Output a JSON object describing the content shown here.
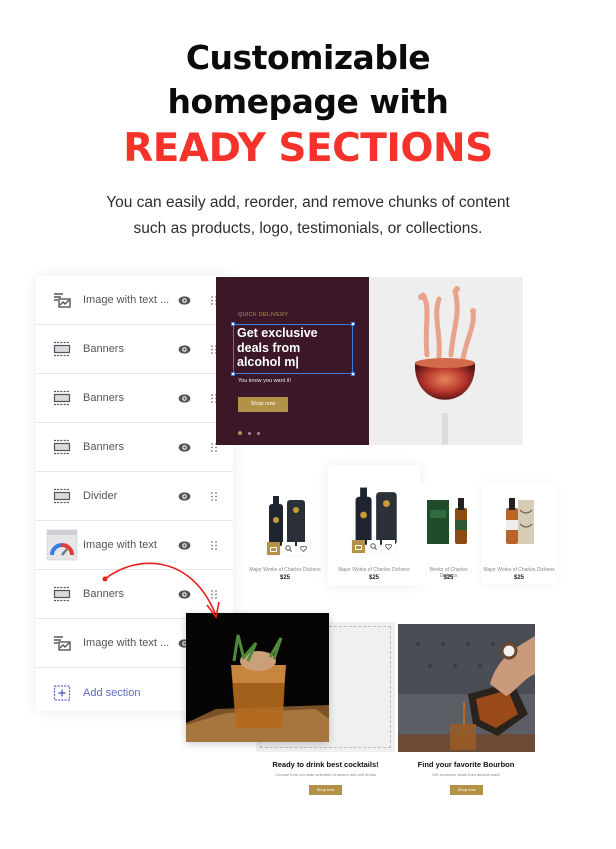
{
  "hero": {
    "title_line1": "Customizable",
    "title_line2": "homepage with",
    "title_highlight": "READY SECTIONS",
    "description": "You can easily add, reorder, and remove chunks of content such as products, logo, testimonials, or collections."
  },
  "colors": {
    "accent_red": "#f5332a",
    "gold": "#b39248",
    "banner_bg": "#3b1728",
    "add_section": "#5b69c6",
    "selection": "#3e7de0"
  },
  "sections_panel": {
    "items": [
      {
        "label": "Image with text ...",
        "icon": "image-with-text-icon"
      },
      {
        "label": "Banners",
        "icon": "banner-icon"
      },
      {
        "label": "Banners",
        "icon": "banner-icon"
      },
      {
        "label": "Banners",
        "icon": "banner-icon"
      },
      {
        "label": "Divider",
        "icon": "divider-icon"
      },
      {
        "label": "Image with text",
        "icon": "speedometer-image-icon"
      },
      {
        "label": "Banners",
        "icon": "banner-icon"
      },
      {
        "label": "Image with text ...",
        "icon": "image-with-text-icon"
      }
    ],
    "add_label": "Add section"
  },
  "banner": {
    "eyebrow": "QUICK DELIVERY",
    "headline": "Get exclusive\ndeals from\nalcohol m|",
    "subtitle": "You know you want it!",
    "button": "Shop now",
    "slides": 3,
    "active_slide": 1
  },
  "products": [
    {
      "title": "Major Works of Charles Dickens",
      "price": "$25"
    },
    {
      "title": "Major Works of Charles Dickens",
      "price": "$25"
    },
    {
      "title": "Works of Charles Dickens",
      "price": "$25"
    },
    {
      "title": "Major Works of Charles Dickens",
      "price": "$25"
    }
  ],
  "collections": [
    {
      "title": "Ready to drink best cocktails!",
      "description": "Choose from our wide selection of mixers and soft drinks",
      "button": "Shop now"
    },
    {
      "title": "Find your favorite Bourbon",
      "description": "Get exclusive deals from alcohol mart!",
      "button": "Shop now"
    }
  ]
}
